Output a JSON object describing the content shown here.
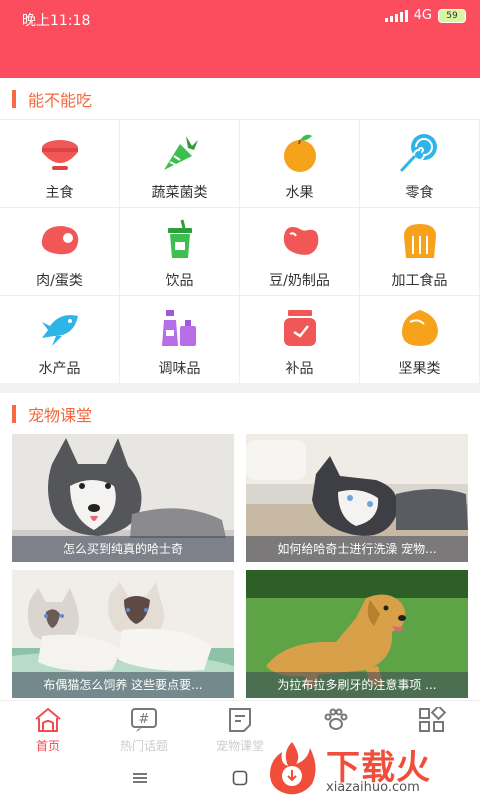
{
  "status_bar": {
    "time": "晚上11:18",
    "network": "4G",
    "battery": "59"
  },
  "section_food": {
    "title": "能不能吃"
  },
  "food_categories": [
    {
      "label": "主食",
      "icon": "rice-bowl-icon"
    },
    {
      "label": "蔬菜菌类",
      "icon": "vegetable-icon"
    },
    {
      "label": "水果",
      "icon": "fruit-icon"
    },
    {
      "label": "零食",
      "icon": "lollipop-icon"
    },
    {
      "label": "肉/蛋类",
      "icon": "meat-icon"
    },
    {
      "label": "饮品",
      "icon": "drink-cup-icon"
    },
    {
      "label": "豆/奶制品",
      "icon": "bean-icon"
    },
    {
      "label": "加工食品",
      "icon": "bread-icon"
    },
    {
      "label": "水产品",
      "icon": "fish-icon"
    },
    {
      "label": "调味品",
      "icon": "condiment-bottles-icon"
    },
    {
      "label": "补品",
      "icon": "supplement-jar-icon"
    },
    {
      "label": "坚果类",
      "icon": "nut-icon"
    }
  ],
  "section_class": {
    "title": "宠物课堂"
  },
  "articles": [
    {
      "title": "怎么买到纯真的哈士奇"
    },
    {
      "title": "如何给哈奇士进行洗澡 宠物..."
    },
    {
      "title": "布偶猫怎么饲养 这些要点要..."
    },
    {
      "title": "为拉布拉多刷牙的注意事项 ..."
    }
  ],
  "tabs": [
    {
      "label": "首页",
      "icon": "home-icon"
    },
    {
      "label": "热门话题",
      "icon": "hashtag-icon"
    },
    {
      "label": "宠物课堂",
      "icon": "notebook-icon"
    },
    {
      "label": "",
      "icon": "paw-icon"
    },
    {
      "label": "",
      "icon": "grid-icon"
    }
  ],
  "watermark": {
    "text": "下载火",
    "url": "xiazaihuo.com"
  },
  "colors": {
    "brand": "#fb4d5e",
    "accent": "#f2683d",
    "active_tab": "#f04e55"
  }
}
